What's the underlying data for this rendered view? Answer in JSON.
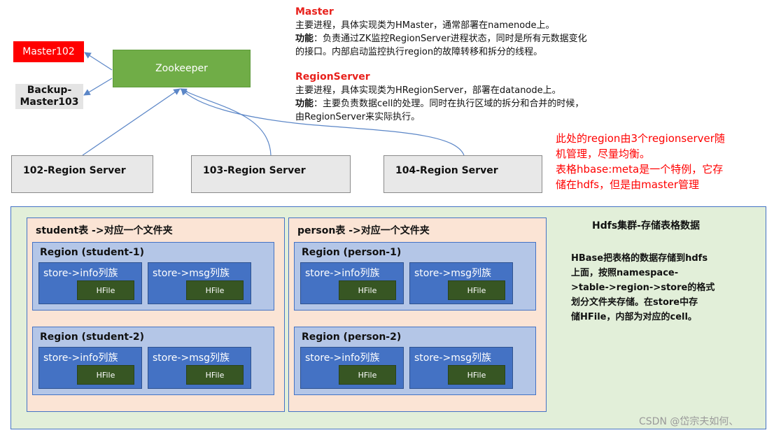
{
  "masters": {
    "active": "Master102",
    "backup_line1": "Backup-",
    "backup_line2": "Master103"
  },
  "zookeeper": "Zookeeper",
  "region_servers": [
    "102-Region Server",
    "103-Region Server",
    "104-Region Server"
  ],
  "descriptions": {
    "master": {
      "title": "Master",
      "line1": "主要进程，具体实现类为HMaster，通常部署在namenode上。",
      "func_label": "功能",
      "func_text": "：负责通过ZK监控RegionServer进程状态，同时是所有元数据变化",
      "line3": "的接口。内部启动监控执行region的故障转移和拆分的线程。"
    },
    "regionserver": {
      "title": "RegionServer",
      "line1": "主要进程，具体实现类为HRegionServer，部署在datanode上。",
      "func_label": "功能",
      "func_text": "：主要负责数据cell的处理。同时在执行区域的拆分和合并的时候，",
      "line3": "由RegionServer来实际执行。"
    }
  },
  "note": {
    "line1": "此处的region由3个regionserver随",
    "line2": "机管理，尽量均衡。",
    "line3": "表格hbase:meta是一个特例，它存",
    "line4": "储在hdfs，但是由master管理"
  },
  "hdfs": {
    "title": "Hdfs集群-存储表格数据",
    "desc1": "HBase把表格的数据存储到hdfs",
    "desc2": "上面，按照namespace-",
    "desc3": ">table->region->store的格式",
    "desc4": "划分文件夹存储。在store中存",
    "desc5": "储HFile，内部为对应的cell。"
  },
  "tables": [
    {
      "title": "student表 ->对应一个文件夹",
      "regions": [
        {
          "title": "Region (student-1)",
          "stores": [
            "store->info列族",
            "store->msg列族"
          ]
        },
        {
          "title": "Region (student-2)",
          "stores": [
            "store->info列族",
            "store->msg列族"
          ]
        }
      ]
    },
    {
      "title": "person表 ->对应一个文件夹",
      "regions": [
        {
          "title": "Region (person-1)",
          "stores": [
            "store->info列族",
            "store->msg列族"
          ]
        },
        {
          "title": "Region (person-2)",
          "stores": [
            "store->info列族",
            "store->msg列族"
          ]
        }
      ]
    }
  ],
  "hfile_label": "HFile",
  "watermark": "CSDN @岱宗夫如何、",
  "colors": {
    "master": "#ff0000",
    "zookeeper": "#70ad47",
    "region_server": "#e8e8e8",
    "hdfs": "#e2efd9",
    "table": "#fbe4d5",
    "region": "#b4c6e7",
    "store": "#4472c4",
    "hfile": "#375623",
    "note_text": "#ff0000",
    "connector": "#5b86c7"
  }
}
